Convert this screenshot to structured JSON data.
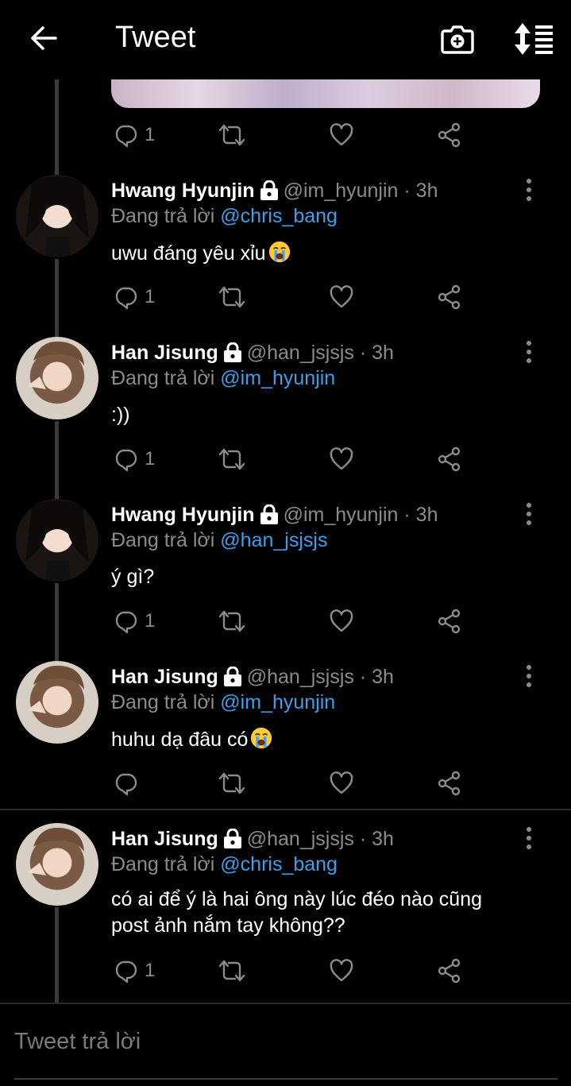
{
  "header": {
    "title": "Tweet",
    "back_icon": "arrow-left-icon",
    "camera_icon": "camera-add-icon",
    "sort_icon": "sort-list-icon"
  },
  "top_actions": {
    "reply_count": "1"
  },
  "tweets": [
    {
      "name": "Hwang Hyunjin",
      "handle": "@im_hyunjin · 3h",
      "reply_prefix": "Đang trả lời ",
      "reply_to": "@chris_bang",
      "text": "uwu đáng yêu xỉu",
      "emoji": "crying-face",
      "reply_count": "1"
    },
    {
      "name": "Han Jisung",
      "handle": "@han_jsjsjs · 3h",
      "reply_prefix": "Đang trả lời ",
      "reply_to": "@im_hyunjin",
      "text": ":))",
      "reply_count": "1"
    },
    {
      "name": "Hwang Hyunjin",
      "handle": "@im_hyunjin · 3h",
      "reply_prefix": "Đang trả lời ",
      "reply_to": "@han_jsjsjs",
      "text": "ý gì?",
      "reply_count": "1"
    },
    {
      "name": "Han Jisung",
      "handle": "@han_jsjsjs · 3h",
      "reply_prefix": "Đang trả lời ",
      "reply_to": "@im_hyunjin",
      "text": "huhu dạ đâu có",
      "emoji": "crying-face",
      "reply_count": ""
    },
    {
      "name": "Han Jisung",
      "handle": "@han_jsjsjs · 3h",
      "reply_prefix": "Đang trả lời ",
      "reply_to": "@chris_bang",
      "text_line1": "có ai để ý là hai ông này lúc đéo nào cũng",
      "text_line2": "post ảnh nắm tay không??",
      "reply_count": "1"
    }
  ],
  "reply_input": {
    "placeholder": "Tweet trả lời"
  },
  "colors": {
    "background": "#000000",
    "accent": "#3d9ee9",
    "muted": "#8b8b8b"
  }
}
